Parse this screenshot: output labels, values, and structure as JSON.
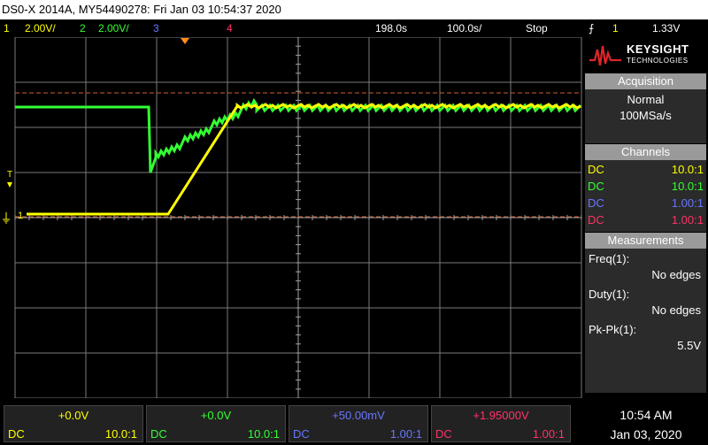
{
  "header": {
    "title": "DS0-X 2014A, MY54490278: Fri Jan 03 10:54:37 2020"
  },
  "status": {
    "ch1_num": "1",
    "ch1_scale": "2.00V/",
    "ch2_num": "2",
    "ch2_scale": "2.00V/",
    "ch3_num": "3",
    "ch4_num": "4",
    "time_delay": "198.0s",
    "time_scale": "100.0s/",
    "run_state": "Stop",
    "trigger_icon": "⨍",
    "trigger_source": "1",
    "trigger_level": "1.33V"
  },
  "logo": {
    "brand": "KEYSIGHT",
    "sub": "TECHNOLOGIES"
  },
  "acquisition": {
    "title": "Acquisition",
    "mode": "Normal",
    "rate": "100MSa/s"
  },
  "channels": {
    "title": "Channels",
    "rows": [
      {
        "coupling": "DC",
        "ratio": "10.0:1",
        "color": "#ffff00"
      },
      {
        "coupling": "DC",
        "ratio": "10.0:1",
        "color": "#33ff33"
      },
      {
        "coupling": "DC",
        "ratio": "1.00:1",
        "color": "#6677ff"
      },
      {
        "coupling": "DC",
        "ratio": "1.00:1",
        "color": "#ff3366"
      }
    ]
  },
  "measurements": {
    "title": "Measurements",
    "items": [
      {
        "label": "Freq(1):",
        "value": "No edges"
      },
      {
        "label": "Duty(1):",
        "value": "No edges"
      },
      {
        "label": "Pk-Pk(1):",
        "value": "5.5V"
      }
    ]
  },
  "bottom_channels": [
    {
      "offset": "+0.0V",
      "coupling": "DC",
      "ratio": "10.0:1",
      "color": "#ffff00"
    },
    {
      "offset": "+0.0V",
      "coupling": "DC",
      "ratio": "10.0:1",
      "color": "#33ff33"
    },
    {
      "offset": "+50.00mV",
      "coupling": "DC",
      "ratio": "1.00:1",
      "color": "#6677ff"
    },
    {
      "offset": "+1.95000V",
      "coupling": "DC",
      "ratio": "1.00:1",
      "color": "#ff3366"
    }
  ],
  "clock": {
    "time": "10:54 AM",
    "date": "Jan 03, 2020"
  },
  "markers": {
    "ch1_ground": "1",
    "trigger_marker": "T"
  },
  "colors": {
    "ch1": "#ffff00",
    "ch2": "#33ff33",
    "ch3": "#6677ff",
    "ch4": "#ff3366",
    "grid": "#808080",
    "cursor": "#ff8844"
  }
}
